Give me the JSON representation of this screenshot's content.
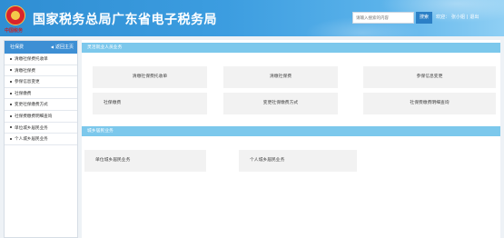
{
  "header": {
    "emblem_caption": "中国税务",
    "title": "国家税务总局广东省电子税务局",
    "search_placeholder": "请输入搜索的内容",
    "search_button": "搜索",
    "welcome": "欢迎：",
    "username": "张小姐",
    "separator": "|",
    "logout": "退出"
  },
  "sidebar": {
    "title": "社保费",
    "back_label": "返回主页",
    "items": [
      "清缴社保费托收单",
      "清缴社保费",
      "参保信息变更",
      "社保缴费",
      "变更社保缴费方式",
      "社保费缴费明细查询",
      "单位城乡居民业务",
      "个人城乡居民业务"
    ]
  },
  "sections": [
    {
      "title": "灵活就业人员业务",
      "items": [
        "清缴社保费托收单",
        "清缴社保费",
        "参保信息变更",
        "社保缴费",
        "变更社保缴费方式",
        "社保费缴费明细查询"
      ]
    },
    {
      "title": "城乡居民业务",
      "items": [
        "单位城乡居民业务",
        "个人城乡居民业务"
      ]
    }
  ],
  "colors": {
    "header_blue": "#3c9de0",
    "sidebar_head": "#3d8fd4",
    "section_bar": "#7cc8ec"
  }
}
